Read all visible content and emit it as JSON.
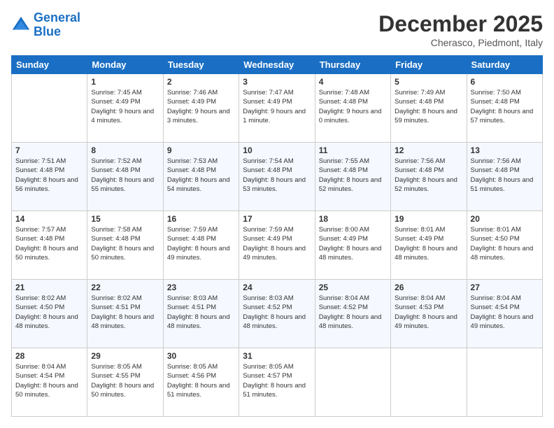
{
  "logo": {
    "line1": "General",
    "line2": "Blue"
  },
  "header": {
    "month": "December 2025",
    "location": "Cherasco, Piedmont, Italy"
  },
  "days_of_week": [
    "Sunday",
    "Monday",
    "Tuesday",
    "Wednesday",
    "Thursday",
    "Friday",
    "Saturday"
  ],
  "weeks": [
    [
      {
        "day": "",
        "sunrise": "",
        "sunset": "",
        "daylight": ""
      },
      {
        "day": "1",
        "sunrise": "Sunrise: 7:45 AM",
        "sunset": "Sunset: 4:49 PM",
        "daylight": "Daylight: 9 hours and 4 minutes."
      },
      {
        "day": "2",
        "sunrise": "Sunrise: 7:46 AM",
        "sunset": "Sunset: 4:49 PM",
        "daylight": "Daylight: 9 hours and 3 minutes."
      },
      {
        "day": "3",
        "sunrise": "Sunrise: 7:47 AM",
        "sunset": "Sunset: 4:49 PM",
        "daylight": "Daylight: 9 hours and 1 minute."
      },
      {
        "day": "4",
        "sunrise": "Sunrise: 7:48 AM",
        "sunset": "Sunset: 4:48 PM",
        "daylight": "Daylight: 9 hours and 0 minutes."
      },
      {
        "day": "5",
        "sunrise": "Sunrise: 7:49 AM",
        "sunset": "Sunset: 4:48 PM",
        "daylight": "Daylight: 8 hours and 59 minutes."
      },
      {
        "day": "6",
        "sunrise": "Sunrise: 7:50 AM",
        "sunset": "Sunset: 4:48 PM",
        "daylight": "Daylight: 8 hours and 57 minutes."
      }
    ],
    [
      {
        "day": "7",
        "sunrise": "Sunrise: 7:51 AM",
        "sunset": "Sunset: 4:48 PM",
        "daylight": "Daylight: 8 hours and 56 minutes."
      },
      {
        "day": "8",
        "sunrise": "Sunrise: 7:52 AM",
        "sunset": "Sunset: 4:48 PM",
        "daylight": "Daylight: 8 hours and 55 minutes."
      },
      {
        "day": "9",
        "sunrise": "Sunrise: 7:53 AM",
        "sunset": "Sunset: 4:48 PM",
        "daylight": "Daylight: 8 hours and 54 minutes."
      },
      {
        "day": "10",
        "sunrise": "Sunrise: 7:54 AM",
        "sunset": "Sunset: 4:48 PM",
        "daylight": "Daylight: 8 hours and 53 minutes."
      },
      {
        "day": "11",
        "sunrise": "Sunrise: 7:55 AM",
        "sunset": "Sunset: 4:48 PM",
        "daylight": "Daylight: 8 hours and 52 minutes."
      },
      {
        "day": "12",
        "sunrise": "Sunrise: 7:56 AM",
        "sunset": "Sunset: 4:48 PM",
        "daylight": "Daylight: 8 hours and 52 minutes."
      },
      {
        "day": "13",
        "sunrise": "Sunrise: 7:56 AM",
        "sunset": "Sunset: 4:48 PM",
        "daylight": "Daylight: 8 hours and 51 minutes."
      }
    ],
    [
      {
        "day": "14",
        "sunrise": "Sunrise: 7:57 AM",
        "sunset": "Sunset: 4:48 PM",
        "daylight": "Daylight: 8 hours and 50 minutes."
      },
      {
        "day": "15",
        "sunrise": "Sunrise: 7:58 AM",
        "sunset": "Sunset: 4:48 PM",
        "daylight": "Daylight: 8 hours and 50 minutes."
      },
      {
        "day": "16",
        "sunrise": "Sunrise: 7:59 AM",
        "sunset": "Sunset: 4:48 PM",
        "daylight": "Daylight: 8 hours and 49 minutes."
      },
      {
        "day": "17",
        "sunrise": "Sunrise: 7:59 AM",
        "sunset": "Sunset: 4:49 PM",
        "daylight": "Daylight: 8 hours and 49 minutes."
      },
      {
        "day": "18",
        "sunrise": "Sunrise: 8:00 AM",
        "sunset": "Sunset: 4:49 PM",
        "daylight": "Daylight: 8 hours and 48 minutes."
      },
      {
        "day": "19",
        "sunrise": "Sunrise: 8:01 AM",
        "sunset": "Sunset: 4:49 PM",
        "daylight": "Daylight: 8 hours and 48 minutes."
      },
      {
        "day": "20",
        "sunrise": "Sunrise: 8:01 AM",
        "sunset": "Sunset: 4:50 PM",
        "daylight": "Daylight: 8 hours and 48 minutes."
      }
    ],
    [
      {
        "day": "21",
        "sunrise": "Sunrise: 8:02 AM",
        "sunset": "Sunset: 4:50 PM",
        "daylight": "Daylight: 8 hours and 48 minutes."
      },
      {
        "day": "22",
        "sunrise": "Sunrise: 8:02 AM",
        "sunset": "Sunset: 4:51 PM",
        "daylight": "Daylight: 8 hours and 48 minutes."
      },
      {
        "day": "23",
        "sunrise": "Sunrise: 8:03 AM",
        "sunset": "Sunset: 4:51 PM",
        "daylight": "Daylight: 8 hours and 48 minutes."
      },
      {
        "day": "24",
        "sunrise": "Sunrise: 8:03 AM",
        "sunset": "Sunset: 4:52 PM",
        "daylight": "Daylight: 8 hours and 48 minutes."
      },
      {
        "day": "25",
        "sunrise": "Sunrise: 8:04 AM",
        "sunset": "Sunset: 4:52 PM",
        "daylight": "Daylight: 8 hours and 48 minutes."
      },
      {
        "day": "26",
        "sunrise": "Sunrise: 8:04 AM",
        "sunset": "Sunset: 4:53 PM",
        "daylight": "Daylight: 8 hours and 49 minutes."
      },
      {
        "day": "27",
        "sunrise": "Sunrise: 8:04 AM",
        "sunset": "Sunset: 4:54 PM",
        "daylight": "Daylight: 8 hours and 49 minutes."
      }
    ],
    [
      {
        "day": "28",
        "sunrise": "Sunrise: 8:04 AM",
        "sunset": "Sunset: 4:54 PM",
        "daylight": "Daylight: 8 hours and 50 minutes."
      },
      {
        "day": "29",
        "sunrise": "Sunrise: 8:05 AM",
        "sunset": "Sunset: 4:55 PM",
        "daylight": "Daylight: 8 hours and 50 minutes."
      },
      {
        "day": "30",
        "sunrise": "Sunrise: 8:05 AM",
        "sunset": "Sunset: 4:56 PM",
        "daylight": "Daylight: 8 hours and 51 minutes."
      },
      {
        "day": "31",
        "sunrise": "Sunrise: 8:05 AM",
        "sunset": "Sunset: 4:57 PM",
        "daylight": "Daylight: 8 hours and 51 minutes."
      },
      {
        "day": "",
        "sunrise": "",
        "sunset": "",
        "daylight": ""
      },
      {
        "day": "",
        "sunrise": "",
        "sunset": "",
        "daylight": ""
      },
      {
        "day": "",
        "sunrise": "",
        "sunset": "",
        "daylight": ""
      }
    ]
  ]
}
